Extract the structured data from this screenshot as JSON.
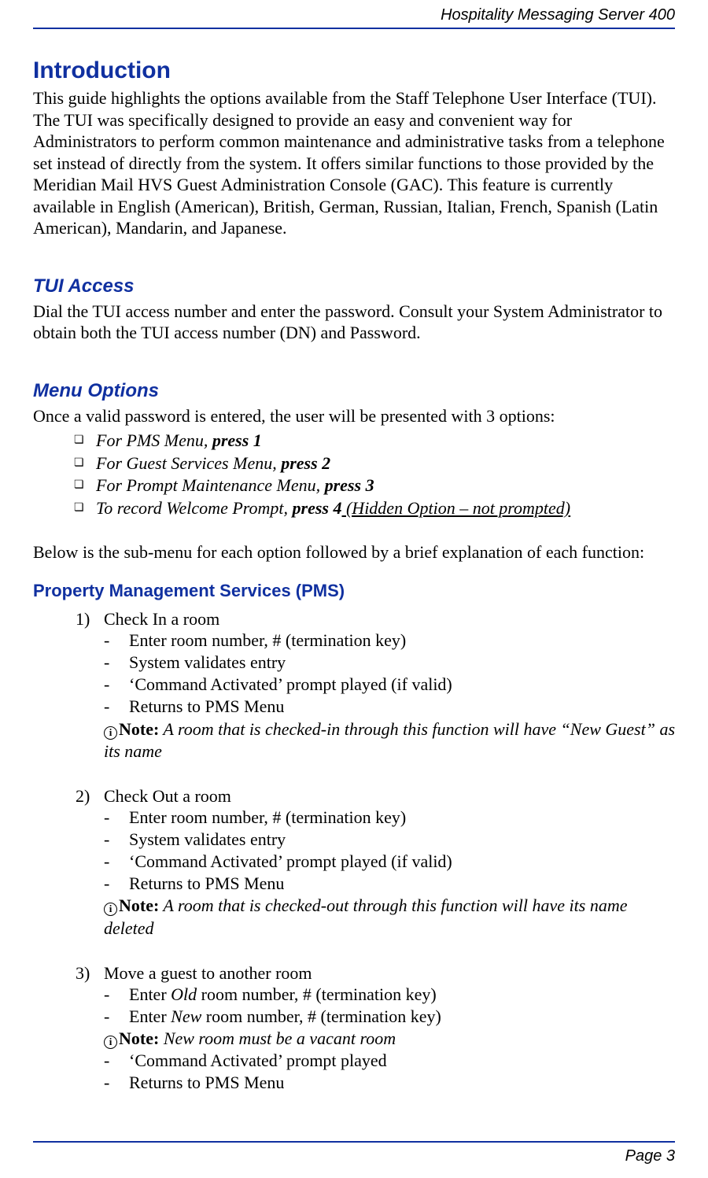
{
  "header": {
    "title": "Hospitality Messaging Server 400"
  },
  "footer": {
    "page_label": "Page 3"
  },
  "sections": {
    "intro": {
      "heading": "Introduction",
      "body": "This guide highlights the options available from the Staff Telephone User Interface (TUI). The TUI was specifically designed to provide an easy and convenient way for Administrators to perform common maintenance and administrative tasks from a telephone set instead of directly from the system. It offers similar functions to those provided by the Meridian Mail HVS Guest Administration Console (GAC). This feature is currently available in English (American), British, German, Russian, Italian, French, Spanish (Latin American), Mandarin, and Japanese."
    },
    "tui_access": {
      "heading": "TUI Access",
      "body": "Dial the TUI access number and enter the password. Consult your System Administrator to obtain both the TUI access number (DN) and Password."
    },
    "menu_options": {
      "heading": "Menu Options",
      "intro": "Once a valid password is entered, the user will be presented with 3 options:",
      "items": [
        {
          "prefix": "For PMS Menu, ",
          "action": "press 1",
          "suffix": ""
        },
        {
          "prefix": "For Guest Services Menu, ",
          "action": "press 2",
          "suffix": ""
        },
        {
          "prefix": "For Prompt Maintenance Menu, ",
          "action": "press 3",
          "suffix": ""
        },
        {
          "prefix": "To record Welcome Prompt, ",
          "action": "press 4",
          "suffix": " (Hidden Option – not prompted)"
        }
      ],
      "below": "Below is the sub-menu for each option followed by a brief explanation of each function:"
    },
    "pms": {
      "heading": "Property Management Services (PMS)",
      "items": [
        {
          "num": "1)",
          "title": "Check In a room",
          "steps": [
            "Enter room number, # (termination key)",
            "System validates entry",
            "‘Command Activated’ prompt played (if valid)",
            "Returns to PMS Menu"
          ],
          "note_label": "Note:",
          "note_text": " A room that is checked-in through this function will have “New Guest” as its name"
        },
        {
          "num": "2)",
          "title": "Check Out a room",
          "steps": [
            "Enter room number, # (termination key)",
            "System validates entry",
            "‘Command Activated’ prompt played (if valid)",
            "Returns to PMS Menu"
          ],
          "note_label": "Note:",
          "note_text": " A room that is checked-out through this function will have its name deleted"
        },
        {
          "num": "3)",
          "title": "Move a guest to another room",
          "steps_pre": [
            {
              "dash": "-",
              "pre": "Enter ",
              "em": "Old",
              "post": " room number, # (termination key)"
            },
            {
              "dash": "-",
              "pre": "Enter ",
              "em": "New",
              "post": " room number, # (termination key)"
            }
          ],
          "note_label": "Note:",
          "note_text": " New room must be a vacant room",
          "steps_post": [
            "‘Command Activated’ prompt played",
            "Returns to PMS Menu"
          ]
        }
      ]
    }
  }
}
